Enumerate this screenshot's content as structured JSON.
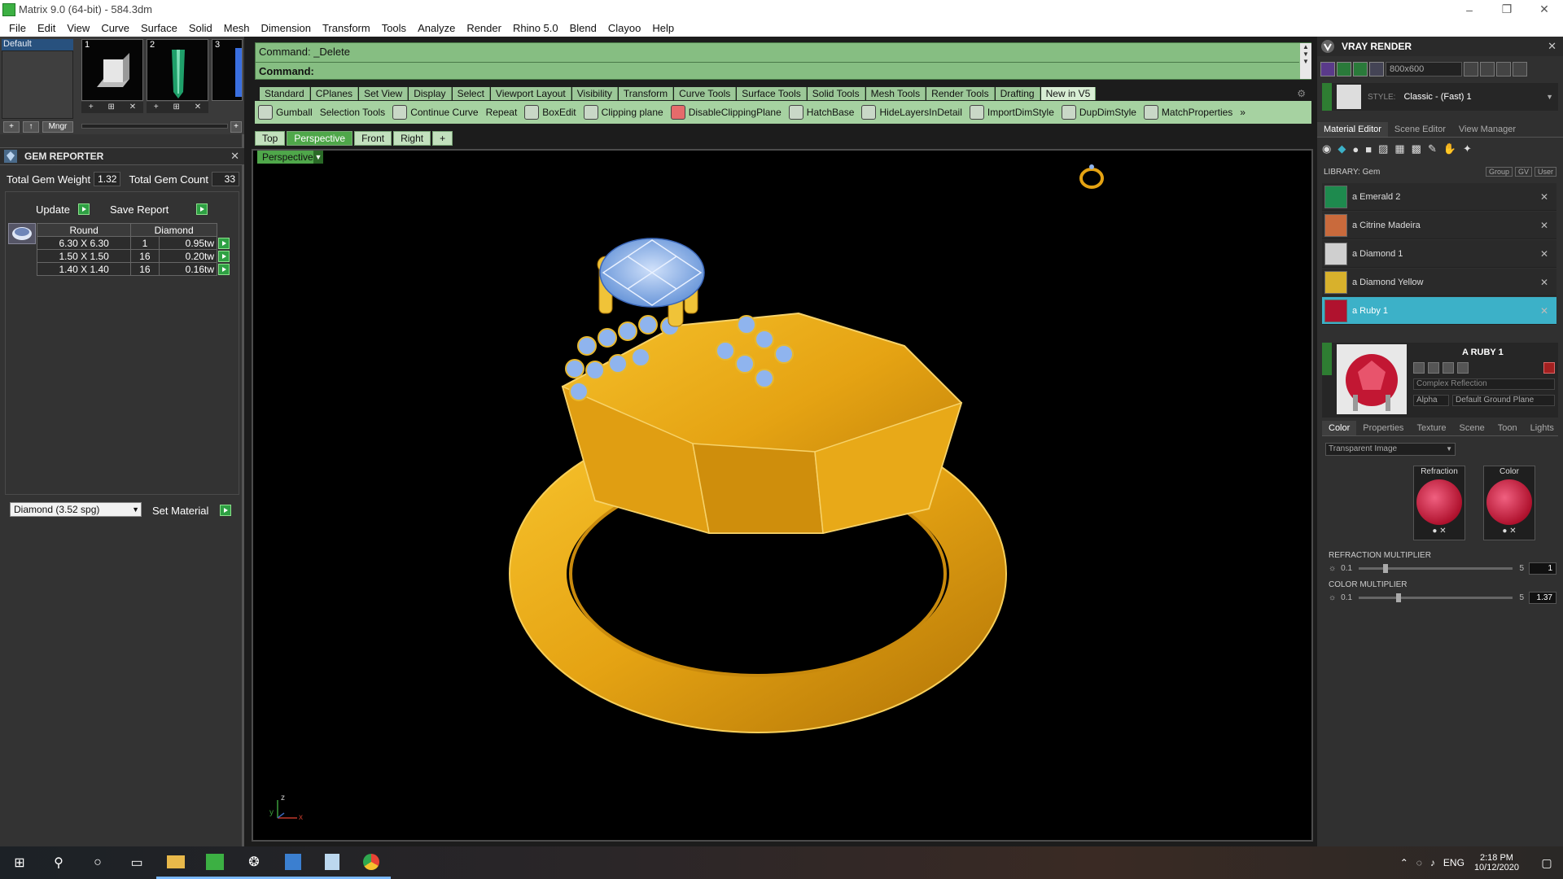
{
  "window": {
    "title": "Matrix 9.0 (64-bit) - 584.3dm",
    "minimize": "–",
    "maximize": "❐",
    "close": "✕"
  },
  "menu": [
    "File",
    "Edit",
    "View",
    "Curve",
    "Surface",
    "Solid",
    "Mesh",
    "Dimension",
    "Transform",
    "Tools",
    "Analyze",
    "Render",
    "Rhino 5.0",
    "Blend",
    "Clayoo",
    "Help"
  ],
  "left": {
    "layer_name": "Default",
    "thumbnails": [
      "1",
      "2",
      "3"
    ],
    "thumb_tools": [
      "+",
      "⊞",
      "✕"
    ],
    "mngr_label": "Mngr",
    "gem_reporter": {
      "title": "GEM REPORTER",
      "total_weight_label": "Total Gem Weight",
      "total_weight": "1.32",
      "total_count_label": "Total Gem Count",
      "total_count": "33",
      "update_label": "Update",
      "save_label": "Save Report",
      "table_headers": [
        "Round",
        "Diamond"
      ],
      "rows": [
        {
          "size": "6.30 X 6.30",
          "count": "1",
          "weight": "0.95tw"
        },
        {
          "size": "1.50 X 1.50",
          "count": "16",
          "weight": "0.20tw"
        },
        {
          "size": "1.40 X 1.40",
          "count": "16",
          "weight": "0.16tw"
        }
      ],
      "material_select": "Diamond    (3.52 spg)",
      "set_material_label": "Set Material"
    }
  },
  "command": {
    "line1": "Command: _Delete",
    "line2": "Command:"
  },
  "toolbar_tabs": [
    "Standard",
    "CPlanes",
    "Set View",
    "Display",
    "Select",
    "Viewport Layout",
    "Visibility",
    "Transform",
    "Curve Tools",
    "Surface Tools",
    "Solid Tools",
    "Mesh Tools",
    "Render Tools",
    "Drafting",
    "New in V5"
  ],
  "active_toolbar_tab": "New in V5",
  "tools": [
    "Gumball",
    "Selection Tools",
    "Continue Curve",
    "Repeat",
    "BoxEdit",
    "Clipping plane",
    "DisableClippingPlane",
    "HatchBase",
    "HideLayersInDetail",
    "ImportDimStyle",
    "DupDimStyle",
    "MatchProperties"
  ],
  "tools_more": "»",
  "view_tabs": [
    "Top",
    "Perspective",
    "Front",
    "Right"
  ],
  "view_add": "+",
  "active_view": "Perspective",
  "viewport": {
    "label": "Perspective",
    "axis_x": "x",
    "axis_y": "y",
    "axis_z": "z"
  },
  "vray": {
    "title": "VRAY RENDER",
    "resolution": "800x600",
    "style_label": "STYLE:",
    "style_value": "Classic - (Fast) 1",
    "tabs": [
      "Material Editor",
      "Scene Editor",
      "View Manager"
    ],
    "library_label": "LIBRARY: Gem",
    "library_buttons": [
      "Group",
      "GV",
      "User"
    ],
    "materials": [
      {
        "name": "a Emerald 2",
        "color": "#1e8a4e"
      },
      {
        "name": "a Citrine Madeira",
        "color": "#c96a3c"
      },
      {
        "name": "a Diamond 1",
        "color": "#cfcfcf"
      },
      {
        "name": "a Diamond Yellow",
        "color": "#d8b12c"
      },
      {
        "name": "a Ruby 1",
        "color": "#b0122e"
      }
    ],
    "selected_material": "a Ruby 1",
    "preview_title": "A RUBY 1",
    "reflection": "Complex Reflection",
    "alpha_label": "Alpha",
    "ground": "Default Ground Plane",
    "sub_tabs": [
      "Color",
      "Properties",
      "Texture",
      "Scene",
      "Toon",
      "Lights"
    ],
    "color_mode": "Transparent Image",
    "swatch_refraction": "Refraction",
    "swatch_color": "Color",
    "refraction_multiplier_label": "REFRACTION MULTIPLIER",
    "refraction_min": "0.1",
    "refraction_max": "5",
    "refraction_value": "1",
    "color_multiplier_label": "COLOR MULTIPLIER",
    "color_min": "0.1",
    "color_max": "5",
    "color_value": "1.37"
  },
  "taskbar": {
    "time": "2:18 PM",
    "date": "10/12/2020",
    "lang": "ENG"
  },
  "colors": {
    "accent_green": "#4fa74a",
    "command_bg": "#86be82",
    "ring_gold": "#e8a418",
    "gem_blue": "#7aa6e6",
    "selected_cyan": "#3cb1c8"
  }
}
